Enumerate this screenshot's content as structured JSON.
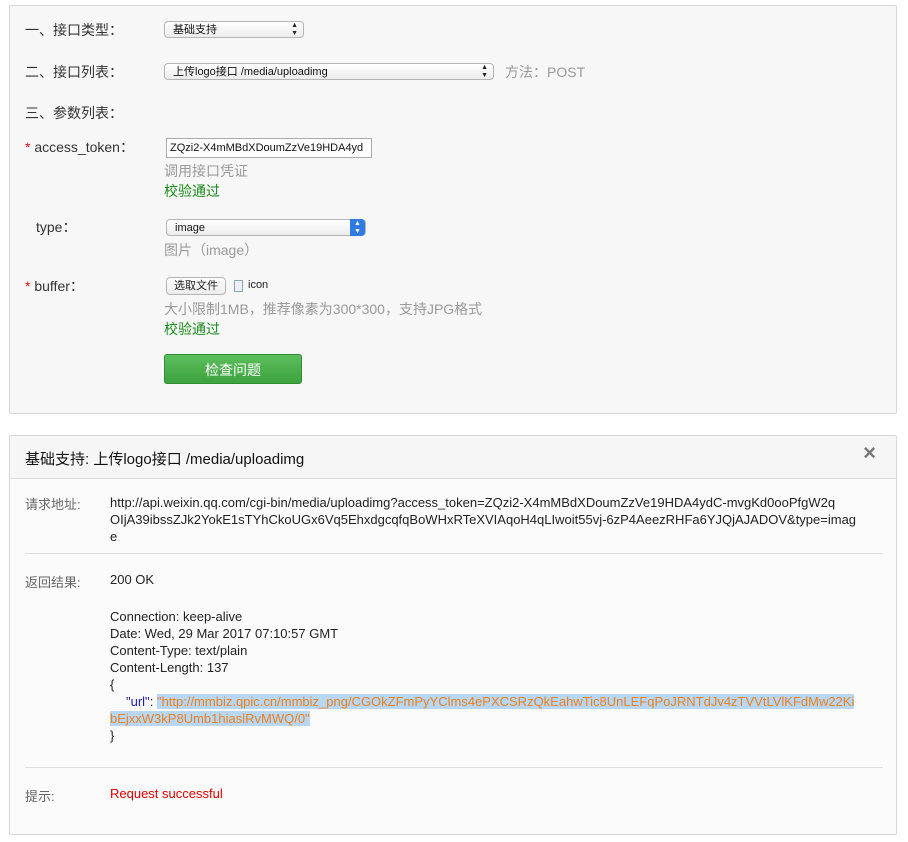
{
  "form": {
    "interface_type_label": "一、接口类型：",
    "interface_type_value": "基础支持",
    "interface_list_label": "二、接口列表：",
    "interface_list_value": "上传logo接口 /media/uploadimg",
    "method_text": "方法：POST",
    "params_label": "三、参数列表：",
    "params": [
      {
        "required_mark": "*",
        "name": "access_token：",
        "value": "ZQzi2-X4mMBdXDoumZzVe19HDA4yd",
        "hint": "调用接口凭证",
        "status": "校验通过"
      },
      {
        "name": "type：",
        "value": "image",
        "hint": "图片（image）"
      },
      {
        "required_mark": "*",
        "name": "buffer：",
        "file_button": "选取文件",
        "file_name": "icon",
        "hint": "大小限制1MB，推荐像素为300*300，支持JPG格式",
        "status": "校验通过"
      }
    ],
    "check_button": "检查问题"
  },
  "result": {
    "title": "基础支持: 上传logo接口 /media/uploadimg",
    "close": "×",
    "request_url_label": "请求地址:",
    "request_url_line1": "http://api.weixin.qq.com/cgi-bin/media/uploadimg?access_token=ZQzi2-X4mMBdXDoumZzVe19HDA4ydC-mvgKd0ooPfgW2q",
    "request_url_line2": "OIjA39ibssZJk2YokE1sTYhCkoUGx6Vq5EhxdgcqfqBoWHxRTeXVIAqoH4qLIwoit55vj-6zP4AeezRHFa6YJQjAJADOV&type=imag",
    "request_url_line3": "e",
    "return_label": "返回结果:",
    "status_line": "200 OK",
    "headers": [
      "Connection: keep-alive",
      "Date: Wed, 29 Mar 2017 07:10:57 GMT",
      "Content-Type: text/plain",
      "Content-Length: 137"
    ],
    "brace_open": "{",
    "json_key": "\"url\"",
    "json_colon": ": ",
    "json_value_line1": "\"http://mmbiz.qpic.cn/mmbiz_png/CGOkZFmPyYClms4ePXCSRzQkEahwTic8UnLEFqPoJRNTdJv4zTVVtLVlKFdMw22Ki",
    "json_value_line2": "bEjxxW3kP8Umb1hiaslRvMWQ/0\"",
    "brace_close": "}",
    "tip_label": "提示:",
    "tip_value": "Request successful"
  },
  "colors": {
    "success_green": "#1a8a1a",
    "error_red": "#dd0000",
    "button_green": "#4cae4c",
    "json_string": "#e8821f"
  }
}
